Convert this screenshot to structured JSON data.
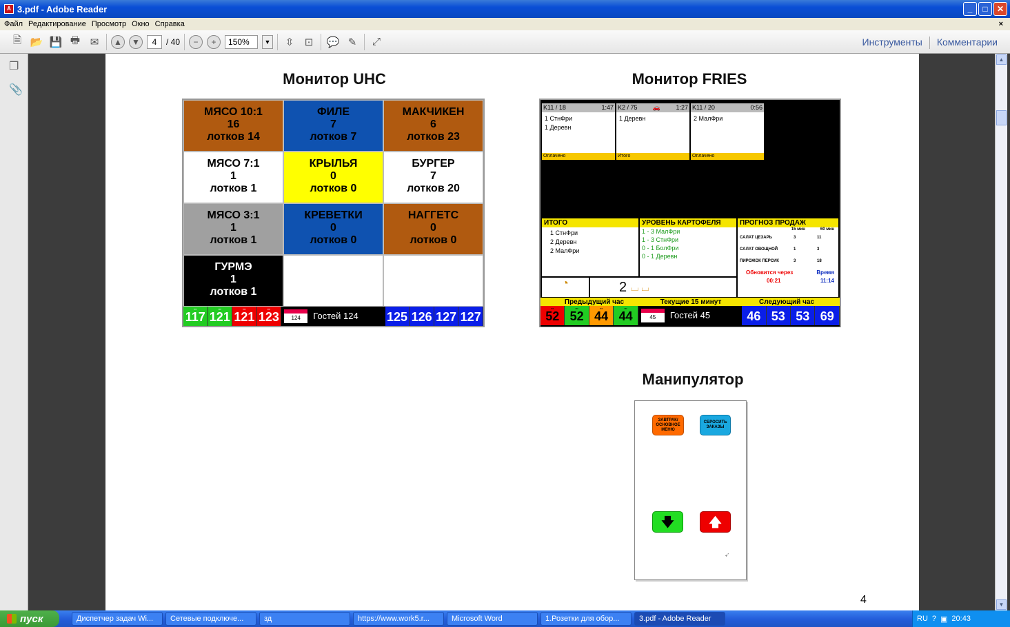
{
  "window": {
    "title": "3.pdf - Adobe Reader"
  },
  "menu": [
    "Файл",
    "Редактирование",
    "Просмотр",
    "Окно",
    "Справка"
  ],
  "toolbar": {
    "page_current": "4",
    "page_total": "/ 40",
    "zoom": "150%",
    "tools": "Инструменты",
    "comments": "Комментарии"
  },
  "page": {
    "number": "4",
    "uhc_title": "Монитор UHC",
    "fries_title": "Монитор FRIES",
    "manip_title": "Манипулятор"
  },
  "uhc": {
    "cells": [
      {
        "l1": "МЯСО 10:1",
        "l2": "16",
        "l3": "лотков 14",
        "bg": "#b05a10",
        "fg": "#000"
      },
      {
        "l1": "ФИЛЕ",
        "l2": "7",
        "l3": "лотков 7",
        "bg": "#0f52b0",
        "fg": "#000"
      },
      {
        "l1": "МАКЧИКЕН",
        "l2": "6",
        "l3": "лотков 23",
        "bg": "#b05a10",
        "fg": "#000"
      },
      {
        "l1": "МЯСО 7:1",
        "l2": "1",
        "l3": "лотков 1",
        "bg": "#ffffff",
        "fg": "#000"
      },
      {
        "l1": "КРЫЛЬЯ",
        "l2": "0",
        "l3": "лотков 0",
        "bg": "#ffff00",
        "fg": "#000"
      },
      {
        "l1": "БУРГЕР",
        "l2": "7",
        "l3": "лотков 20",
        "bg": "#ffffff",
        "fg": "#000"
      },
      {
        "l1": "МЯСО 3:1",
        "l2": "1",
        "l3": "лотков 1",
        "bg": "#a0a0a0",
        "fg": "#000"
      },
      {
        "l1": "КРЕВЕТКИ",
        "l2": "0",
        "l3": "лотков 0",
        "bg": "#0f52b0",
        "fg": "#000"
      },
      {
        "l1": "НАГГЕТС",
        "l2": "0",
        "l3": "лотков 0",
        "bg": "#b05a10",
        "fg": "#000"
      },
      {
        "l1": "ГУРМЭ",
        "l2": "1",
        "l3": "лотков 1",
        "bg": "#000000",
        "fg": "#fff"
      },
      {
        "l1": "",
        "l2": "",
        "l3": "",
        "bg": "#ffffff",
        "fg": "#000"
      },
      {
        "l1": "",
        "l2": "",
        "l3": "",
        "bg": "#ffffff",
        "fg": "#000"
      }
    ],
    "strip_left": [
      {
        "v": "117",
        "bg": "#22cc22"
      },
      {
        "v": "121",
        "bg": "#22cc22"
      },
      {
        "v": "121",
        "bg": "#ee0000"
      },
      {
        "v": "123",
        "bg": "#ee0000"
      }
    ],
    "box_value": "124",
    "guests": "Гостей 124",
    "strip_right": [
      "125",
      "126",
      "127",
      "127"
    ]
  },
  "fries": {
    "cards": [
      {
        "id": "K11 / 18",
        "time": "1:47",
        "items": [
          "1 СтнФри",
          "1 Деревн"
        ],
        "foot": "Оплачено"
      },
      {
        "id": "K2 / 75",
        "time": "1:27",
        "items": [
          "1 Деревн"
        ],
        "foot": "Итого"
      },
      {
        "id": "K11 / 20",
        "time": "0:56",
        "items": [
          "2 МалФри"
        ],
        "foot": "Оплачено"
      }
    ],
    "total_head": "ИТОГО",
    "total_items": [
      "1 СтнФри",
      "2 Деревн",
      "2 МалФри"
    ],
    "potato_head": "УРОВЕНЬ КАРТОФЕЛЯ",
    "potato_items": [
      "1 - 3  МалФри",
      "1 - 3  СтнФри",
      "0 - 1  БолФри",
      "0 - 1  Деревн"
    ],
    "forecast_head": "ПРОГНОЗ ПРОДАЖ",
    "forecast_cols": [
      "15 мин",
      "60 мин"
    ],
    "forecast_rows": [
      {
        "name": "САЛАТ ЦЕЗАРЬ",
        "a": "3",
        "b": "11"
      },
      {
        "name": "САЛАТ ОВОЩНОЙ",
        "a": "1",
        "b": "3"
      },
      {
        "name": "ПИРОЖОК ПЕРСИК",
        "a": "3",
        "b": "18"
      }
    ],
    "update_label": "Обновится через",
    "update_value": "00:21",
    "time_label": "Время",
    "time_value": "11:14",
    "basket_count": "2",
    "prev_hour": "Предыдущий час",
    "cur_15": "Текущие 15 минут",
    "next_hour": "Следующий час",
    "strip_left": [
      {
        "v": "52",
        "bg": "#ee0000"
      },
      {
        "v": "52",
        "bg": "#22cc22"
      },
      {
        "v": "44",
        "bg": "#ff9900"
      },
      {
        "v": "44",
        "bg": "#22cc22"
      }
    ],
    "box_value": "45",
    "guests": "Гостей 45",
    "strip_right": [
      "46",
      "53",
      "53",
      "69"
    ]
  },
  "manip": {
    "btn1": "ЗАВТРАК/ ОСНОВНОЕ МЕНЮ",
    "btn2": "СБРОСИТЬ ЗАКАЗЫ"
  },
  "taskbar": {
    "start": "пуск",
    "tasks": [
      "Диспетчер задач Wi...",
      "Сетевые подключе...",
      "зд",
      "https://www.work5.r...",
      "Microsoft Word",
      "1.Розетки для обор...",
      "3.pdf - Adobe Reader"
    ],
    "lang": "RU",
    "clock": "20:43"
  }
}
